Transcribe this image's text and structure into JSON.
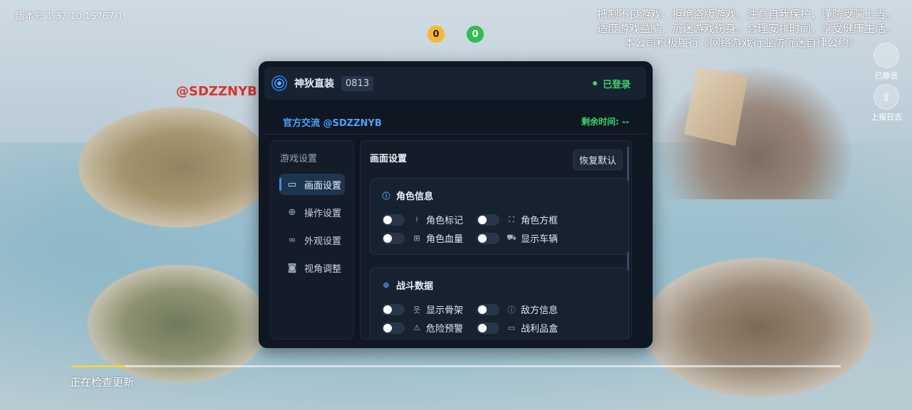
{
  "app": {
    "version": "版本号 1.37.10.15767.1",
    "notice_lines": [
      "抵制不良游戏，拒绝盗版游戏。注意自我保护，谨防受骗上当。",
      "适度游戏益脑，沉迷游戏伤身。合理安排时间，享受健康生活。",
      "本公司积极履行《网络游戏行业防沉迷自律公约》"
    ],
    "coins": {
      "gold": "0",
      "green": "0"
    },
    "side_buttons": {
      "mute": "已静音",
      "report": "上报日志"
    },
    "watermark": "@SDZZNYB",
    "update_text": "正在检查更新",
    "update_progress": 0.07
  },
  "panel": {
    "title": "神狄直装",
    "tag": "0813",
    "status": "已登录",
    "official": "官方交流 @SDZZNYB",
    "remaining": "剩余时间: --",
    "sidebar": {
      "header": "游戏设置",
      "items": [
        {
          "label": "画面设置",
          "icon": "monitor-icon",
          "active": true
        },
        {
          "label": "操作设置",
          "icon": "crosshair-icon",
          "active": false
        },
        {
          "label": "外观设置",
          "icon": "appearance-icon",
          "active": false
        },
        {
          "label": "视角调整",
          "icon": "camera-icon",
          "active": false
        }
      ]
    },
    "content": {
      "title": "画面设置",
      "reset_label": "恢复默认",
      "sections": [
        {
          "title": "角色信息",
          "icon": "info-icon",
          "options": [
            {
              "label": "角色标记",
              "icon": "marker-icon",
              "on": false
            },
            {
              "label": "角色方框",
              "icon": "frame-icon",
              "on": false
            },
            {
              "label": "角色血量",
              "icon": "health-icon",
              "on": false
            },
            {
              "label": "显示车辆",
              "icon": "vehicle-icon",
              "on": false
            }
          ]
        },
        {
          "title": "战斗数据",
          "icon": "target-icon",
          "options": [
            {
              "label": "显示骨架",
              "icon": "skeleton-icon",
              "on": false
            },
            {
              "label": "敌方信息",
              "icon": "info-icon",
              "on": false
            },
            {
              "label": "危险预警",
              "icon": "warning-icon",
              "on": false
            },
            {
              "label": "战利品盒",
              "icon": "box-icon",
              "on": false
            }
          ]
        }
      ]
    }
  }
}
